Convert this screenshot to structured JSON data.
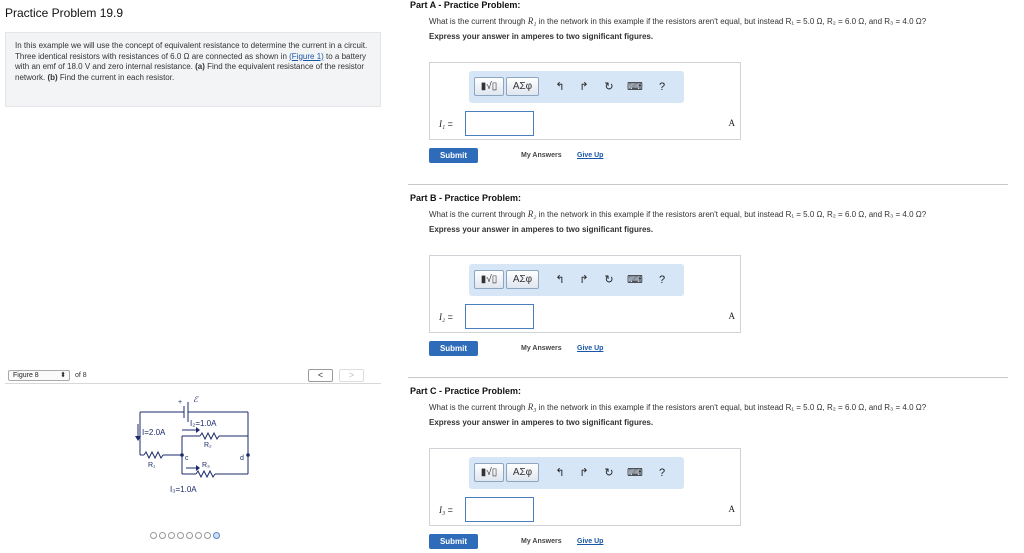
{
  "left": {
    "title": "Practice Problem 19.9",
    "intro": {
      "text_1": "In this example we will use the concept of equivalent resistance to determine the current in a circuit. Three identical resistors with resistances of 6.0 Ω are connected as shown in ",
      "figure_link": "(Figure 1)",
      "text_2": " to a battery with an emf of 18.0 V and zero internal resistance. ",
      "part_a": "(a)",
      "text_3": " Find the equivalent resistance of the resistor network. ",
      "part_b": "(b)",
      "text_4": " Find the current in each resistor."
    },
    "figure_nav": {
      "select_value": "Figure 8",
      "of_text": "of 8",
      "prev": "<",
      "next": ">"
    },
    "circuit_labels": {
      "emf_plus": "+",
      "emf": "ℰ",
      "current_total": "I=2.0A",
      "current_2": "I₂=1.0A",
      "r2": "R₂",
      "r1": "R₁",
      "node_c": "c",
      "node_d": "d",
      "r3": "R₃",
      "current_3": "I₃=1.0A"
    },
    "dots_count": 8,
    "active_dot": 7
  },
  "parts": [
    {
      "heading": "Part A - Practice Problem:",
      "q_pre": "What is the current through ",
      "q_var": "R₁",
      "q_post": " in the network in this example if the resistors aren't equal, but instead R₁ = 5.0 Ω, R₂ = 6.0 Ω, and R₃ = 4.0 Ω?",
      "express": "Express your answer in amperes to two significant figures.",
      "var": "I₁",
      "unit": "A",
      "submit": "Submit",
      "my_answers": "My Answers",
      "give_up": "Give Up"
    },
    {
      "heading": "Part B - Practice Problem:",
      "q_pre": "What is the current through ",
      "q_var": "R₂",
      "q_post": " in the network in this example if the resistors aren't equal, but instead R₁ = 5.0 Ω, R₂ = 6.0 Ω, and R₃ = 4.0 Ω?",
      "express": "Express your answer in amperes to two significant figures.",
      "var": "I₂",
      "unit": "A",
      "submit": "Submit",
      "my_answers": "My Answers",
      "give_up": "Give Up"
    },
    {
      "heading": "Part C - Practice Problem:",
      "q_pre": "What is the current through ",
      "q_var": "R₃",
      "q_post": " in the network in this example if the resistors aren't equal, but instead R₁ = 5.0 Ω, R₂ = 6.0 Ω, and R₃ = 4.0 Ω?",
      "express": "Express your answer in amperes to two significant figures.",
      "var": "I₃",
      "unit": "A",
      "submit": "Submit",
      "my_answers": "My Answers",
      "give_up": "Give Up"
    }
  ],
  "toolbar": {
    "templates": "▮√▯",
    "symbols": "ΑΣφ",
    "undo": "↰",
    "redo": "↱",
    "reset": "↻",
    "keyboard": "⌨",
    "help": "?"
  },
  "colors": {
    "accent": "#2e6bb8",
    "toolbar_bg": "#d7e6f7",
    "link": "#1a56a8"
  }
}
